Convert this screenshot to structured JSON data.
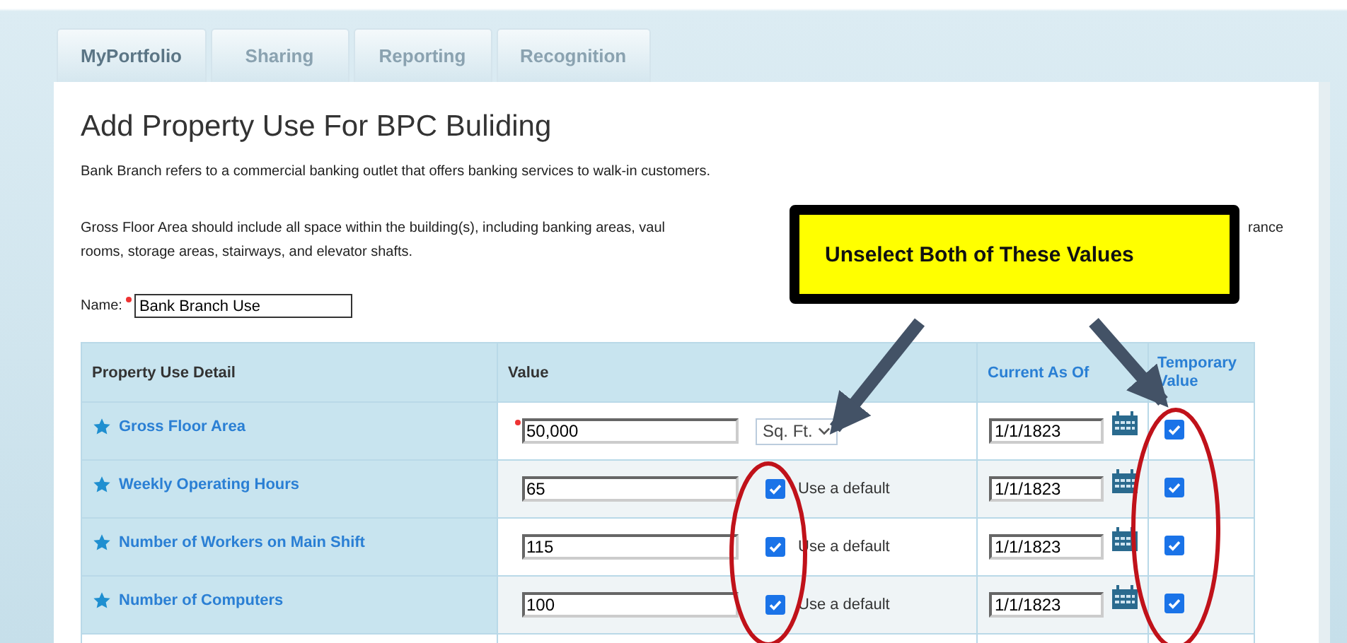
{
  "tabs": [
    {
      "label": "MyPortfolio",
      "selected": true
    },
    {
      "label": "Sharing",
      "selected": false
    },
    {
      "label": "Reporting",
      "selected": false
    },
    {
      "label": "Recognition",
      "selected": false
    }
  ],
  "title": "Add Property Use For BPC Buliding",
  "intro": "Bank Branch refers to a commercial banking outlet that offers banking services to walk-in customers.",
  "gfa_note": {
    "line_1_start": "Gross Floor Area should include all space within the building(s), including banking areas, vaul",
    "line_1_end": "rance",
    "line_2": "rooms, storage areas, stairways, and elevator shafts."
  },
  "name_field": {
    "label": "Name:",
    "required": true,
    "value": "Bank Branch Use"
  },
  "table": {
    "columns": [
      "Property Use Detail",
      "Value",
      "Current As Of",
      "Temporary Value"
    ],
    "rows": [
      {
        "label": "Gross Floor Area",
        "required": true,
        "value": "50,000",
        "kind": "unit",
        "unit": "Sq. Ft.",
        "date": "1/1/1823",
        "temporary": true
      },
      {
        "label": "Weekly Operating Hours",
        "required": false,
        "value": "65",
        "kind": "default",
        "use_default_label": "Use a default",
        "use_default": true,
        "date": "1/1/1823",
        "temporary": true
      },
      {
        "label": "Number of Workers on Main Shift",
        "required": false,
        "value": "115",
        "kind": "default",
        "use_default_label": "Use a default",
        "use_default": true,
        "date": "1/1/1823",
        "temporary": true
      },
      {
        "label": "Number of Computers",
        "required": false,
        "value": "100",
        "kind": "default",
        "use_default_label": "Use a default",
        "use_default": true,
        "date": "1/1/1823",
        "temporary": true
      }
    ]
  },
  "callout": "Unselect Both of These Values"
}
